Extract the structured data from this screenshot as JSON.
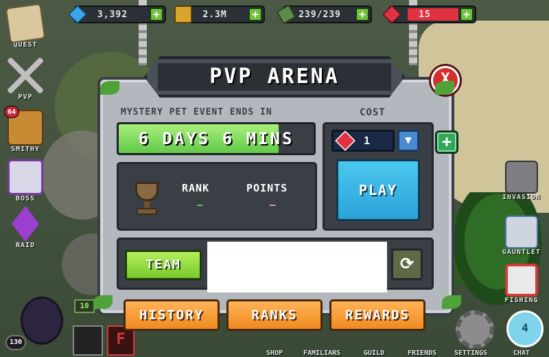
{
  "resources": {
    "gems": "3,392",
    "gold": "2.3M",
    "energy": "239/239",
    "tickets": "15"
  },
  "left_menu": [
    {
      "id": "quest",
      "label": "QUEST"
    },
    {
      "id": "pvp",
      "label": "PVP"
    },
    {
      "id": "smithy",
      "label": "SMITHY",
      "badge": "64"
    },
    {
      "id": "boss",
      "label": "BOSS"
    },
    {
      "id": "raid",
      "label": "RAID"
    }
  ],
  "right_menu": [
    {
      "id": "invasion",
      "label": "INVASION"
    },
    {
      "id": "gauntlet",
      "label": "GAUNTLET"
    },
    {
      "id": "fishing",
      "label": "FISHING"
    }
  ],
  "bottom_menu": {
    "shop": "SHOP",
    "familiars": "FAMILIARS",
    "guild": "GUILD",
    "friends": "FRIENDS",
    "settings": "SETTINGS",
    "chat": "CHAT",
    "chat_count": "4",
    "player_level": "130",
    "level_tag": "10",
    "f_button": "F"
  },
  "modal": {
    "title": "PVP ARENA",
    "close_glyph": "X",
    "event_label": "MYSTERY PET EVENT ENDS IN",
    "event_timer": "6 DAYS 6 MINS",
    "event_progress": 0.82,
    "rank_label": "RANK",
    "rank_value": "–",
    "points_label": "POINTS",
    "points_value": "–",
    "cost_label": "COST",
    "cost_value": "1",
    "dropdown_glyph": "▼",
    "add_glyph": "+",
    "play_label": "PLAY",
    "team_label": "TEAM",
    "refresh_glyph": "⟳",
    "tabs": [
      "HISTORY",
      "RANKS",
      "REWARDS"
    ]
  },
  "colors": {
    "panel_dark": "#3a3f46",
    "timer_green": "#62c94a",
    "play_blue": "#2ba3d8",
    "team_green": "#78c92d",
    "tab_orange": "#f08a1f",
    "close_red": "#d52e2e",
    "rank_dash": "#6fd06a",
    "points_dash": "#e7a7d6"
  }
}
